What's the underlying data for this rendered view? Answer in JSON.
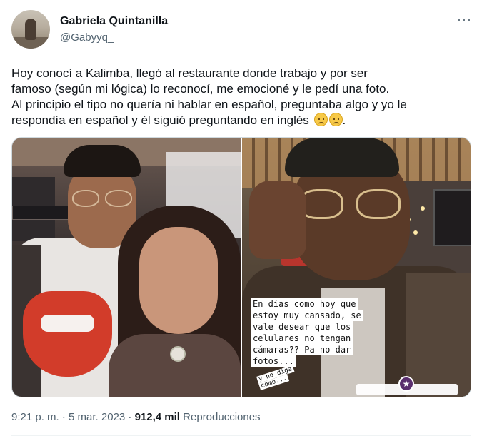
{
  "author": {
    "display_name": "Gabriela Quintanilla",
    "handle": "@Gabyyq_"
  },
  "more_icon": "more-horizontal-icon",
  "tweet_text_lines": [
    "Hoy conocí a Kalimba, llegó al restaurante donde trabajo y por ser",
    "famoso (según mi lógica) lo reconocí, me emocioné y le pedí una foto.",
    "Al principio el tipo no quería ni hablar en español, preguntaba algo y yo le",
    "respondía en español y él siguió preguntando en inglés"
  ],
  "tweet_text_end": ".",
  "emoji": [
    "confused-face-emoji",
    "confused-face-emoji"
  ],
  "story_caption_lines": [
    "En días como hoy que",
    "estoy muy cansado, se",
    "vale desear que los",
    "celulares no tengan",
    "cámaras?? Pa no dar",
    "fotos..."
  ],
  "story_caption_fragment": [
    "y no diga",
    "como..."
  ],
  "timestamp": "9:21 p. m. · 5 mar. 2023 · ",
  "views_count": "912,4 mil",
  "views_label": " Reproducciones"
}
